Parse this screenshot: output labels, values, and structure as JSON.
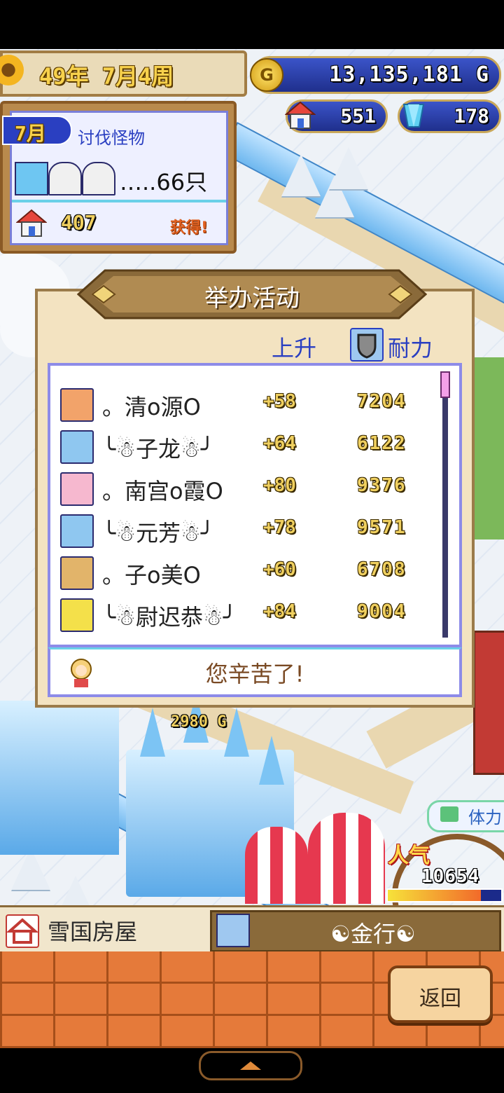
{
  "status": {
    "date": "49年 7月4周",
    "gold": "13,135,181 G",
    "houses": "551",
    "crystals": "178"
  },
  "quest": {
    "month_badge": "7月",
    "title": "讨伐怪物",
    "count": "…..66只",
    "reward_count": "407",
    "reward_label": "获得!"
  },
  "dialog": {
    "title": "举办活动",
    "col_rise": "上升",
    "col_stamina": "耐力",
    "rows": [
      {
        "name": "。清o源O",
        "inc": "+58",
        "val": "7204"
      },
      {
        "name": "╰☃子龙☃╯",
        "inc": "+64",
        "val": "6122"
      },
      {
        "name": "。南宫o霞O",
        "inc": "+80",
        "val": "9376"
      },
      {
        "name": "╰☃元芳☃╯",
        "inc": "+78",
        "val": "9571"
      },
      {
        "name": "。子o美O",
        "inc": "+60",
        "val": "6708"
      },
      {
        "name": "╰☃尉迟恭☃╯",
        "inc": "+84",
        "val": "9004"
      }
    ],
    "footer": "您辛苦了!"
  },
  "map": {
    "price_tag": "2980 G",
    "stamina_label": "体力",
    "popularity_label": "人气",
    "popularity_value": "10654",
    "popularity_fraction": 0.82
  },
  "infobar": {
    "building": "雪国房屋",
    "occupant": "☯金行☯"
  },
  "buttons": {
    "back": "返回"
  },
  "colors": {
    "accent_blue": "#2a3fc1",
    "gold": "#f0d060",
    "dialog_bg": "#f3e3c1",
    "brick": "#e57a3a"
  }
}
